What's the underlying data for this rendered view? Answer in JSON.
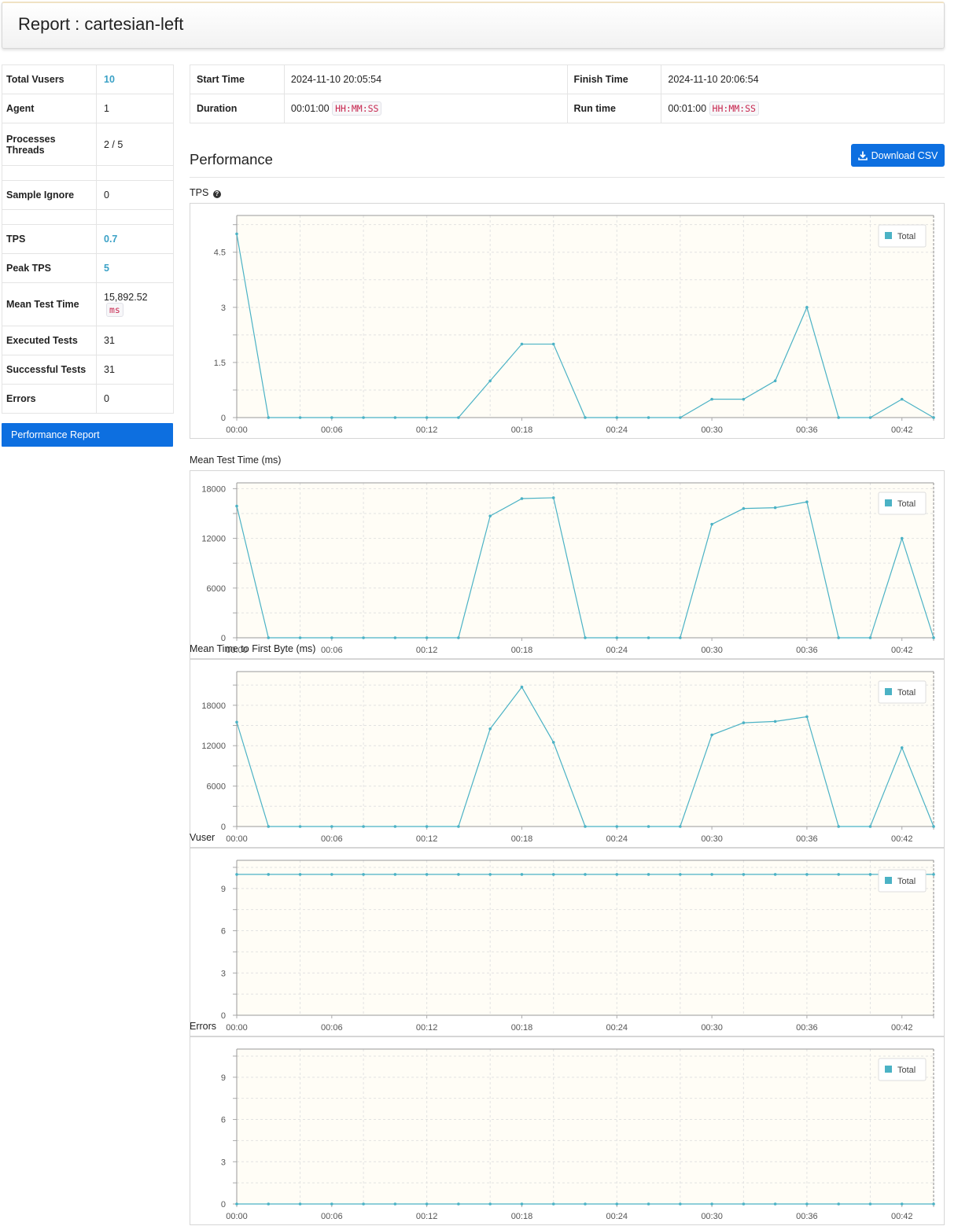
{
  "report": {
    "title": "Report : cartesian-left"
  },
  "stats": {
    "total_vusers": {
      "label": "Total Vusers",
      "value": "10"
    },
    "agent": {
      "label": "Agent",
      "value": "1"
    },
    "processes_threads": {
      "label1": "Processes",
      "label2": "Threads",
      "value": "2 / 5"
    },
    "sample_ignore": {
      "label": "Sample Ignore",
      "value": "0"
    },
    "tps": {
      "label": "TPS",
      "value": "0.7"
    },
    "peak_tps": {
      "label": "Peak TPS",
      "value": "5"
    },
    "mean_test_time": {
      "label": "Mean Test Time",
      "value": "15,892.52",
      "unit": "ms"
    },
    "executed_tests": {
      "label": "Executed Tests",
      "value": "31"
    },
    "successful_tests": {
      "label": "Successful Tests",
      "value": "31"
    },
    "errors": {
      "label": "Errors",
      "value": "0"
    }
  },
  "sidebar": {
    "performance_report": "Performance Report"
  },
  "times": {
    "start_label": "Start Time",
    "start_value": "2024-11-10 20:05:54",
    "finish_label": "Finish Time",
    "finish_value": "2024-11-10 20:06:54",
    "duration_label": "Duration",
    "duration_value": "00:01:00",
    "duration_unit": "HH:MM:SS",
    "runtime_label": "Run time",
    "runtime_value": "00:01:00",
    "runtime_unit": "HH:MM:SS"
  },
  "performance": {
    "title": "Performance",
    "download_label": "Download CSV",
    "download_icon": "download-icon"
  },
  "colors": {
    "series": "#4bb2c5",
    "plot_bg": "#fffdf6",
    "button": "#0d6fe0",
    "highlight": "#3aa1c6"
  },
  "chart_data": [
    {
      "type": "line",
      "title": "TPS",
      "x": [
        "00:00",
        "00:02",
        "00:04",
        "00:06",
        "00:08",
        "00:10",
        "00:12",
        "00:14",
        "00:16",
        "00:18",
        "00:20",
        "00:22",
        "00:24",
        "00:26",
        "00:28",
        "00:30",
        "00:32",
        "00:34",
        "00:36",
        "00:38",
        "00:40",
        "00:42",
        "00:44"
      ],
      "xticks": [
        "00:00",
        "00:06",
        "00:12",
        "00:18",
        "00:24",
        "00:30",
        "00:36",
        "00:42"
      ],
      "yticks": [
        "0",
        "1.5",
        "3",
        "4.5"
      ],
      "ylim": [
        0,
        5.5
      ],
      "grid": true,
      "legend_position": "top-right",
      "series": [
        {
          "name": "Total",
          "values": [
            5,
            0,
            0,
            0,
            0,
            0,
            0,
            0,
            1,
            2,
            2,
            0,
            0,
            0,
            0,
            0.5,
            0.5,
            1,
            3,
            0,
            0,
            0.5,
            0
          ]
        }
      ]
    },
    {
      "type": "line",
      "title": "Mean Test Time (ms)",
      "x": [
        "00:00",
        "00:02",
        "00:04",
        "00:06",
        "00:08",
        "00:10",
        "00:12",
        "00:14",
        "00:16",
        "00:18",
        "00:20",
        "00:22",
        "00:24",
        "00:26",
        "00:28",
        "00:30",
        "00:32",
        "00:34",
        "00:36",
        "00:38",
        "00:40",
        "00:42",
        "00:44"
      ],
      "xticks": [
        "00:00",
        "00:06",
        "00:12",
        "00:18",
        "00:24",
        "00:30",
        "00:36",
        "00:42"
      ],
      "yticks": [
        "0",
        "6000",
        "12000",
        "18000"
      ],
      "ylim": [
        0,
        18700
      ],
      "grid": true,
      "legend_position": "top-right",
      "series": [
        {
          "name": "Total",
          "values": [
            15900,
            0,
            0,
            0,
            0,
            0,
            0,
            0,
            14700,
            16800,
            16900,
            0,
            0,
            0,
            0,
            13700,
            15600,
            15700,
            16400,
            0,
            0,
            12000,
            0
          ]
        }
      ]
    },
    {
      "type": "line",
      "title": "Mean Time to First Byte (ms)",
      "x": [
        "00:00",
        "00:02",
        "00:04",
        "00:06",
        "00:08",
        "00:10",
        "00:12",
        "00:14",
        "00:16",
        "00:18",
        "00:20",
        "00:22",
        "00:24",
        "00:26",
        "00:28",
        "00:30",
        "00:32",
        "00:34",
        "00:36",
        "00:38",
        "00:40",
        "00:42",
        "00:44"
      ],
      "xticks": [
        "00:00",
        "00:06",
        "00:12",
        "00:18",
        "00:24",
        "00:30",
        "00:36",
        "00:42"
      ],
      "yticks": [
        "0",
        "6000",
        "12000",
        "18000"
      ],
      "ylim": [
        0,
        23000
      ],
      "grid": true,
      "legend_position": "top-right",
      "series": [
        {
          "name": "Total",
          "values": [
            15500,
            0,
            0,
            0,
            0,
            0,
            0,
            0,
            14500,
            20700,
            12500,
            0,
            0,
            0,
            0,
            13600,
            15400,
            15600,
            16300,
            0,
            0,
            11700,
            0
          ]
        }
      ]
    },
    {
      "type": "line",
      "title": "Vuser",
      "x": [
        "00:00",
        "00:02",
        "00:04",
        "00:06",
        "00:08",
        "00:10",
        "00:12",
        "00:14",
        "00:16",
        "00:18",
        "00:20",
        "00:22",
        "00:24",
        "00:26",
        "00:28",
        "00:30",
        "00:32",
        "00:34",
        "00:36",
        "00:38",
        "00:40",
        "00:42",
        "00:44"
      ],
      "xticks": [
        "00:00",
        "00:06",
        "00:12",
        "00:18",
        "00:24",
        "00:30",
        "00:36",
        "00:42"
      ],
      "yticks": [
        "0",
        "3",
        "6",
        "9"
      ],
      "ylim": [
        0,
        11
      ],
      "grid": true,
      "legend_position": "top-right",
      "series": [
        {
          "name": "Total",
          "values": [
            10,
            10,
            10,
            10,
            10,
            10,
            10,
            10,
            10,
            10,
            10,
            10,
            10,
            10,
            10,
            10,
            10,
            10,
            10,
            10,
            10,
            10,
            10
          ]
        }
      ]
    },
    {
      "type": "line",
      "title": "Errors",
      "x": [
        "00:00",
        "00:02",
        "00:04",
        "00:06",
        "00:08",
        "00:10",
        "00:12",
        "00:14",
        "00:16",
        "00:18",
        "00:20",
        "00:22",
        "00:24",
        "00:26",
        "00:28",
        "00:30",
        "00:32",
        "00:34",
        "00:36",
        "00:38",
        "00:40",
        "00:42",
        "00:44"
      ],
      "xticks": [
        "00:00",
        "00:06",
        "00:12",
        "00:18",
        "00:24",
        "00:30",
        "00:36",
        "00:42"
      ],
      "yticks": [
        "0",
        "3",
        "6",
        "9"
      ],
      "ylim": [
        0,
        11
      ],
      "grid": true,
      "legend_position": "top-right",
      "series": [
        {
          "name": "Total",
          "values": [
            0,
            0,
            0,
            0,
            0,
            0,
            0,
            0,
            0,
            0,
            0,
            0,
            0,
            0,
            0,
            0,
            0,
            0,
            0,
            0,
            0,
            0,
            0
          ]
        }
      ]
    }
  ]
}
